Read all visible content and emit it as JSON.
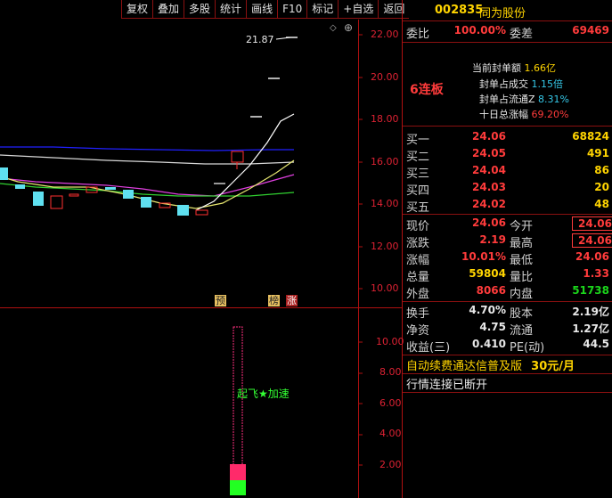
{
  "toolbar": {
    "items": [
      "复权",
      "叠加",
      "多股",
      "统计",
      "画线",
      "F10",
      "标记",
      "+自选",
      "返回"
    ]
  },
  "main_chart": {
    "y_ticks": [
      "22.00",
      "20.00",
      "18.00",
      "16.00",
      "14.00",
      "12.00",
      "10.00"
    ],
    "high_label": "21.87",
    "markers": [
      "预",
      "榜",
      "涨"
    ]
  },
  "sub_chart": {
    "y_ticks": [
      "10.00",
      "8.00",
      "6.00",
      "4.00",
      "2.00"
    ],
    "signal_text": "起飞★加速"
  },
  "stock": {
    "code": "002835",
    "name": "同为股份"
  },
  "order": {
    "wei_bi_label": "委比",
    "wei_bi_value": "100.00%",
    "wei_cha_label": "委差",
    "wei_cha_value": "69469"
  },
  "limit": {
    "board": "6连板",
    "lines": [
      {
        "label": "当前封单额",
        "value": "1.66亿"
      },
      {
        "label": "封单占成交",
        "value": "1.15倍"
      },
      {
        "label": "封单占流通Z",
        "value": "8.31%"
      },
      {
        "label": "十日总涨幅",
        "value": "69.20%"
      }
    ]
  },
  "bids": [
    {
      "label": "买一",
      "price": "24.06",
      "vol": "68824"
    },
    {
      "label": "买二",
      "price": "24.05",
      "vol": "491"
    },
    {
      "label": "买三",
      "price": "24.04",
      "vol": "86"
    },
    {
      "label": "买四",
      "price": "24.03",
      "vol": "20"
    },
    {
      "label": "买五",
      "price": "24.02",
      "vol": "48"
    }
  ],
  "quote": {
    "xianjia_label": "现价",
    "xianjia": "24.06",
    "jinkai_label": "今开",
    "jinkai": "24.06",
    "zhangdie_label": "涨跌",
    "zhangdie": "2.19",
    "zuigao_label": "最高",
    "zuigao": "24.06",
    "zhangfu_label": "涨幅",
    "zhangfu": "10.01%",
    "zuidi_label": "最低",
    "zuidi": "24.06",
    "zongliang_label": "总量",
    "zongliang": "59804",
    "liangbi_label": "量比",
    "liangbi": "1.33",
    "waipan_label": "外盘",
    "waipan": "8066",
    "neipan_label": "内盘",
    "neipan": "51738"
  },
  "finance": {
    "huanshou_label": "换手",
    "huanshou": "4.70%",
    "guben_label": "股本",
    "guben": "2.19亿",
    "jingzi_label": "净资",
    "jingzi": "4.75",
    "liutong_label": "流通",
    "liutong": "1.27亿",
    "shouyi_label": "收益(三)",
    "shouyi": "0.410",
    "pe_label": "PE(动)",
    "pe": "44.5"
  },
  "promo": {
    "text": "自动续费通达信普及版",
    "price": "30元/月"
  },
  "status": {
    "text": "行情连接已断开"
  },
  "colors": {
    "red": "#ff3b3b",
    "green": "#1bd51b",
    "yellow": "#ffd400",
    "grid": "#b01010"
  }
}
